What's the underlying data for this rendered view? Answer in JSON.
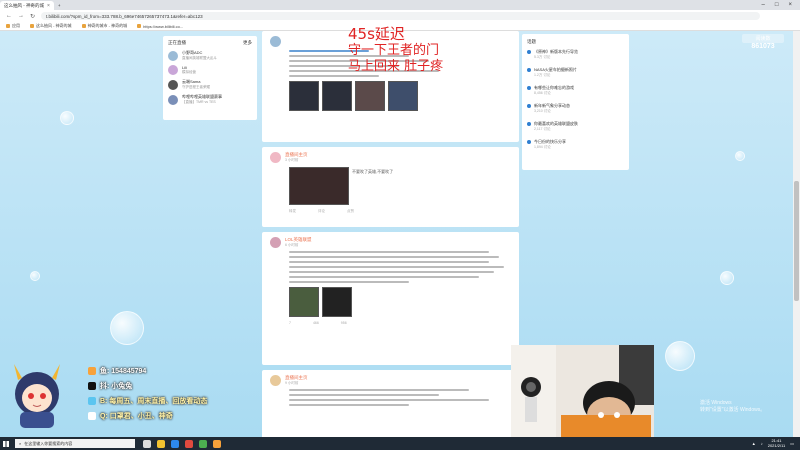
{
  "browser": {
    "tabs": [
      {
        "title": "这么抽风 - 神奇的城",
        "active": true
      },
      {
        "title": "",
        "active": false
      }
    ],
    "url": "t.bilibili.com/?spm_id_from=333.788.b_696e74657265737473.1&refer=abc123",
    "bookmarks": [
      "应用",
      "这么抽风 - 神奇的城",
      "神奇的城市 - 神奇的城",
      "https://www.bilibili.co..."
    ]
  },
  "overlay": {
    "line1": "45s延迟",
    "line2": "守一下王者的门",
    "line3": "马上回来 肚子疼"
  },
  "left_card": {
    "title": "正在直播",
    "more": "更多",
    "items": [
      {
        "name": "小野哥ADC",
        "desc": "直播间英雄联盟大乱斗"
      },
      {
        "name": "Lili",
        "desc": "模拟经营"
      },
      {
        "name": "云端Sama",
        "desc": "守护进程王者荣耀"
      },
      {
        "name": "哔哩哔哩英雄联盟赛事",
        "desc": "【直播】TMR vs TES"
      }
    ]
  },
  "feed": {
    "posts": [
      {
        "name": "",
        "meta": ""
      },
      {
        "name": "直播间主页",
        "meta": "3 小时前",
        "caption": "不要吹了英雄,不要吹了",
        "stats": [
          "转发",
          "评论",
          "点赞"
        ]
      },
      {
        "name": "LOL英雄联盟",
        "meta": "6 小时前",
        "stats": [
          "7",
          "466",
          "956"
        ]
      },
      {
        "name": "直播间主页",
        "meta": "9 小时前"
      }
    ]
  },
  "right_card": {
    "title": "话题",
    "items": [
      {
        "title": "《原神》新版本先行导览",
        "sub": "5.3万 讨论"
      },
      {
        "title": "NASA火星车拍摄新照片",
        "sub": "1.2万 讨论"
      },
      {
        "title": "有哪些让你难忘的游戏",
        "sub": "8,456 讨论"
      },
      {
        "title": "新年新气象分享动态",
        "sub": "3,210 讨论"
      },
      {
        "title": "你最喜欢的英雄联盟皮肤",
        "sub": "2,117 讨论"
      },
      {
        "title": "今日份的快乐分享",
        "sub": "1,894 讨论"
      }
    ]
  },
  "counter": {
    "label": "阅读数",
    "value": "861073"
  },
  "stream": {
    "rows": [
      "鱼: 154845794",
      "抖: 小兔兔",
      "B: 每周五、周末直播、回放看动态",
      "Q: 口罩君、小丑、神奇"
    ]
  },
  "watermark": {
    "line1": "激活 Windows",
    "line2": "转到\"设置\"以激活 Windows。"
  },
  "taskbar": {
    "search_placeholder": "在这里输入你要搜索的内容",
    "time": "21:41",
    "date": "2021/2/11"
  },
  "colors": {
    "overlay_red": "#e02424",
    "accent_blue": "#2f7fd1",
    "name_orange": "#eb7350"
  }
}
